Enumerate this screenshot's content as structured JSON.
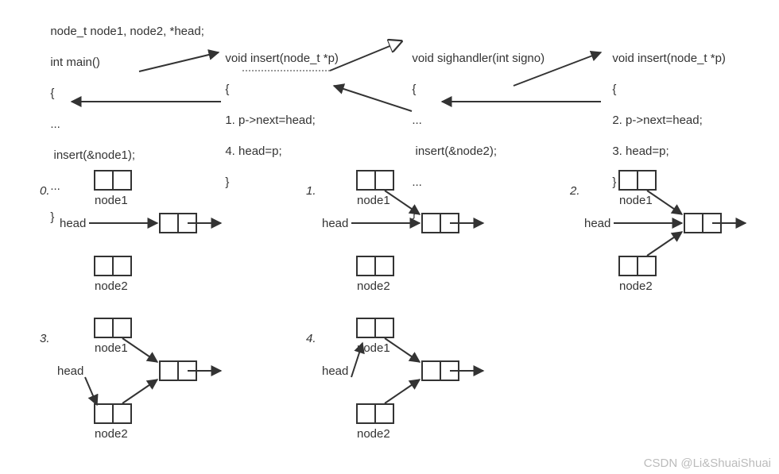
{
  "code": {
    "decl": "node_t node1, node2, *head;",
    "main_sig": "int main()",
    "brace_open": "{",
    "ellipsis": "...",
    "call1": " insert(&node1);",
    "brace_close": "}",
    "insert1_sig": "void insert(node_t *p)",
    "insert1_l1": "1. p->next=head;",
    "insert1_l2": "4. head=p;",
    "sig_sig": "void sighandler(int signo)",
    "sig_call": " insert(&node2);",
    "insert2_sig": "void insert(node_t *p)",
    "insert2_l1": "2. p->next=head;",
    "insert2_l2": "3. head=p;"
  },
  "steps": {
    "s0": "0.",
    "s1": "1.",
    "s2": "2.",
    "s3": "3.",
    "s4": "4."
  },
  "labels": {
    "node1": "node1",
    "node2": "node2",
    "head": "head"
  },
  "watermark": "CSDN @Li&ShuaiShuai"
}
